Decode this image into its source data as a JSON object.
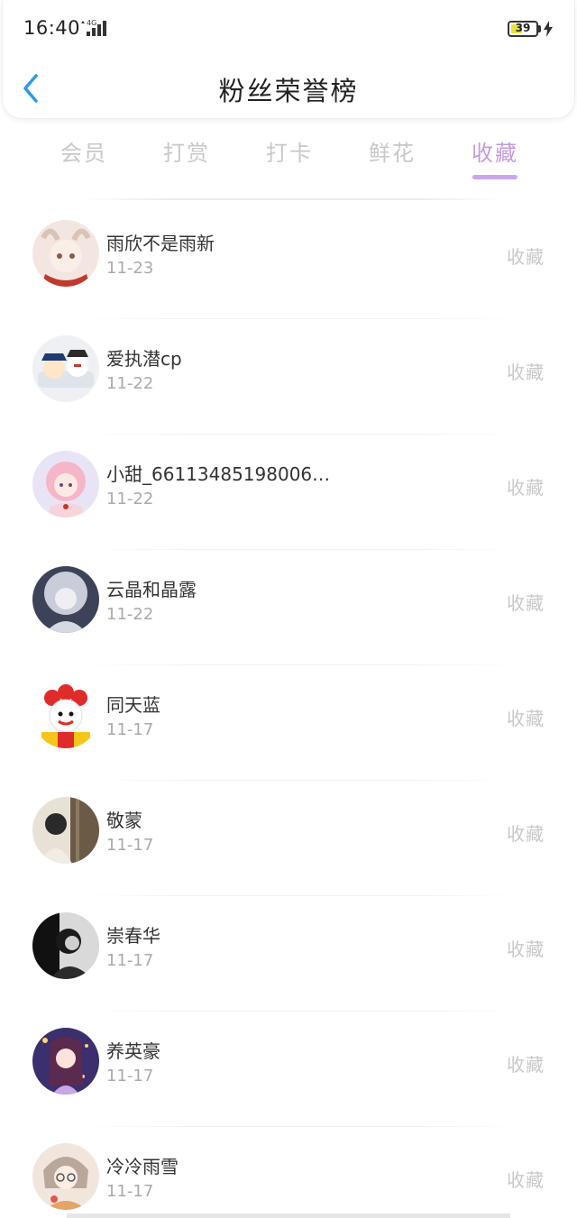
{
  "status_bar": {
    "time": "16:40",
    "network": "4G",
    "battery": "39"
  },
  "header": {
    "title": "粉丝荣誉榜"
  },
  "tabs": [
    {
      "label": "会员",
      "active": false
    },
    {
      "label": "打赏",
      "active": false
    },
    {
      "label": "打卡",
      "active": false
    },
    {
      "label": "鲜花",
      "active": false
    },
    {
      "label": "收藏",
      "active": true
    }
  ],
  "colors": {
    "accent": "#c49be0",
    "muted": "#c8c8c8",
    "back": "#2d9ae8"
  },
  "fans": [
    {
      "name": "雨欣不是雨新",
      "date": "11-23",
      "action": "收藏"
    },
    {
      "name": "爱执潜cp",
      "date": "11-22",
      "action": "收藏"
    },
    {
      "name": "小甜_66113485198006…",
      "date": "11-22",
      "action": "收藏"
    },
    {
      "name": "云晶和晶露",
      "date": "11-22",
      "action": "收藏"
    },
    {
      "name": "同天蓝",
      "date": "11-17",
      "action": "收藏"
    },
    {
      "name": "敬蒙",
      "date": "11-17",
      "action": "收藏"
    },
    {
      "name": "崇春华",
      "date": "11-17",
      "action": "收藏"
    },
    {
      "name": "养英豪",
      "date": "11-17",
      "action": "收藏"
    },
    {
      "name": "冷冷雨雪",
      "date": "11-17",
      "action": "收藏"
    }
  ]
}
